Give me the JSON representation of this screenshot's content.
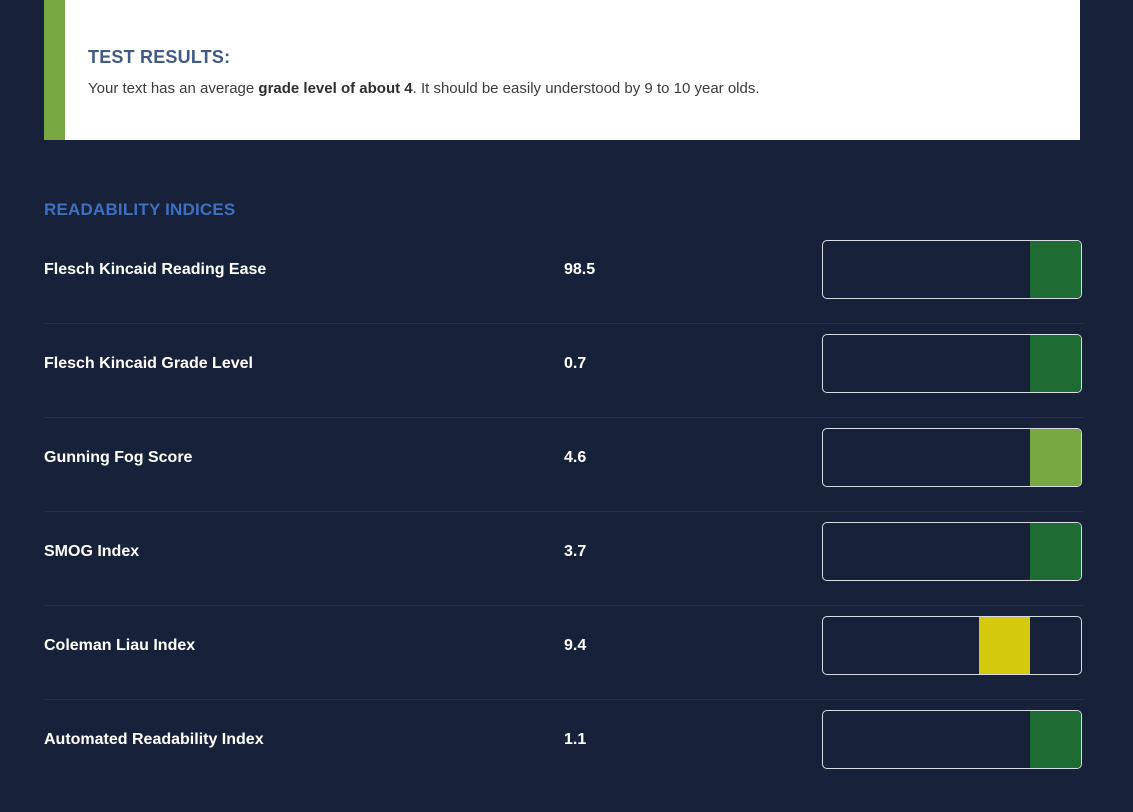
{
  "results": {
    "title": "TEST RESULTS:",
    "text_before": "Your text has an average ",
    "text_bold": "grade level of about 4",
    "text_after": ". It should be easily understood by 9 to 10 year olds."
  },
  "readability": {
    "section_title": "READABILITY INDICES",
    "indices": [
      {
        "name": "Flesch Kincaid Reading Ease",
        "value": "98.5",
        "meter_level": 5,
        "meter_color": "#1e6b33"
      },
      {
        "name": "Flesch Kincaid Grade Level",
        "value": "0.7",
        "meter_level": 5,
        "meter_color": "#1e6b33"
      },
      {
        "name": "Gunning Fog Score",
        "value": "4.6",
        "meter_level": 5,
        "meter_color": "#77a843"
      },
      {
        "name": "SMOG Index",
        "value": "3.7",
        "meter_level": 5,
        "meter_color": "#1e6b33"
      },
      {
        "name": "Coleman Liau Index",
        "value": "9.4",
        "meter_level": 4,
        "meter_color": "#d4c90c"
      },
      {
        "name": "Automated Readability Index",
        "value": "1.1",
        "meter_level": 5,
        "meter_color": "#1e6b33"
      }
    ],
    "meter_levels": 5
  },
  "colors": {
    "background": "#17223a",
    "accent_green": "#77a843",
    "dark_green": "#1e6b33",
    "yellow": "#d4c90c",
    "title_blue": "#3f6fc0"
  }
}
